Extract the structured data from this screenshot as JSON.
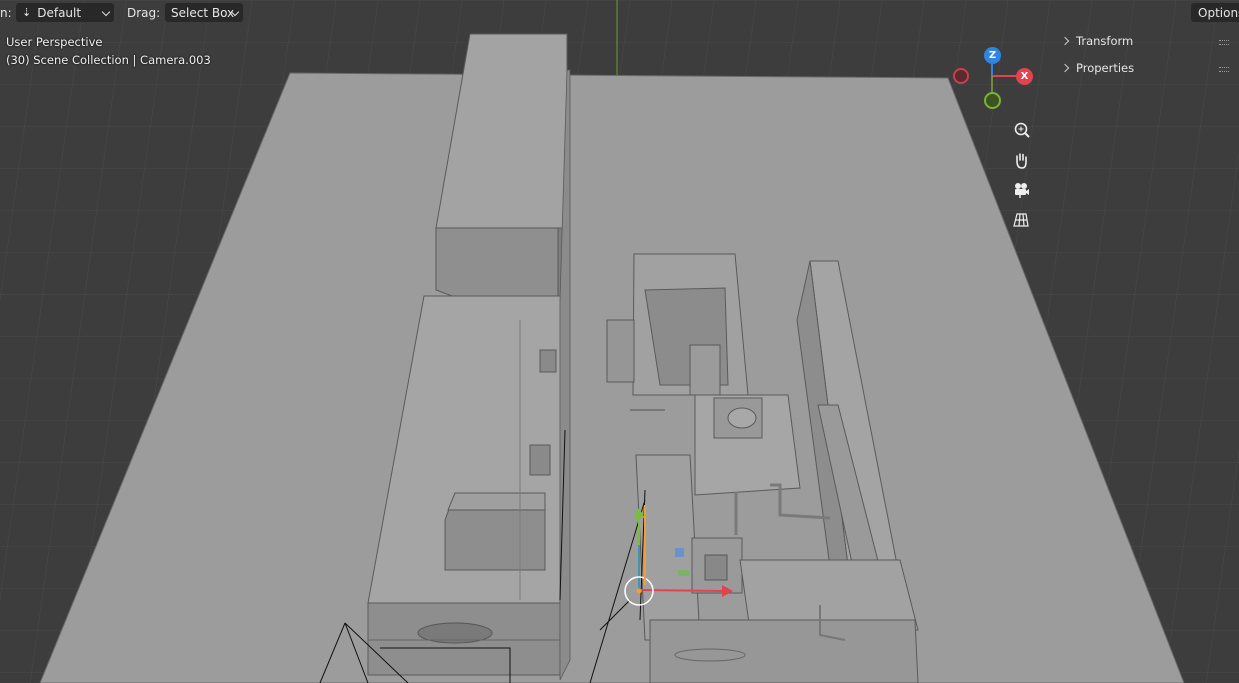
{
  "header": {
    "orientation_label": "n:",
    "orientation_value": "Default",
    "drag_label": "Drag:",
    "drag_value": "Select Box",
    "options_label": "Options"
  },
  "viewport": {
    "view_name": "User Perspective",
    "scene_info": "(30) Scene Collection | Camera.003"
  },
  "sidebar": {
    "transform_label": "Transform",
    "properties_label": "Properties"
  },
  "gizmo": {
    "z_label": "Z",
    "x_label": "X",
    "colors": {
      "x": "#e2434e",
      "y": "#8ac23d",
      "z": "#2f85e0"
    }
  },
  "nav_icons": [
    "zoom-icon",
    "hand-pan-icon",
    "camera-view-icon",
    "grid-ortho-icon"
  ]
}
